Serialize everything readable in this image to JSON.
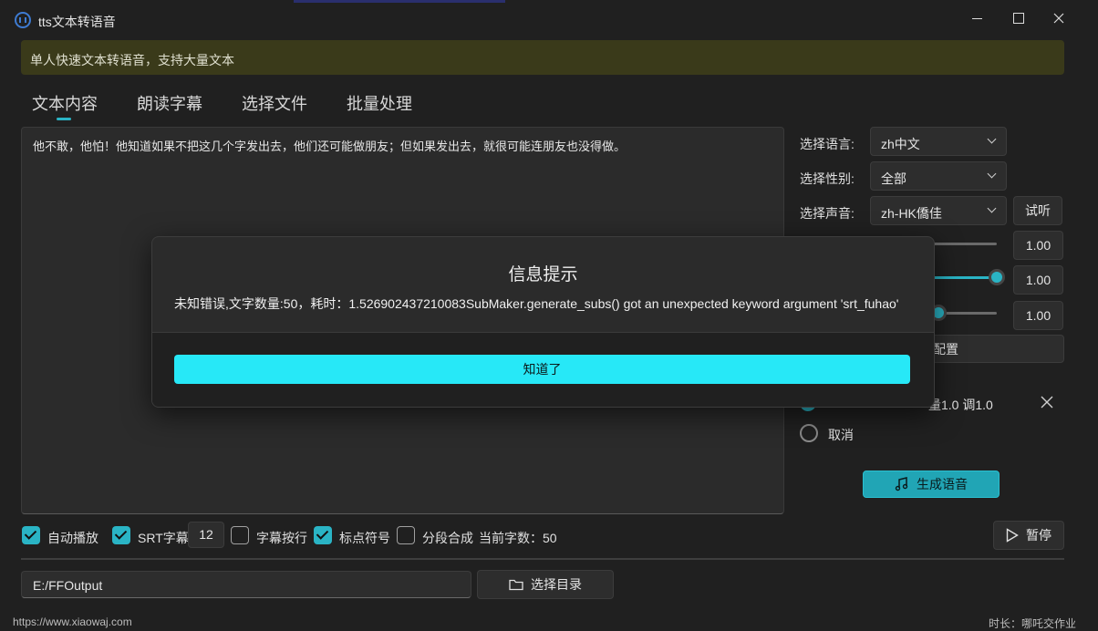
{
  "window": {
    "title": "tts文本转语音"
  },
  "banner": {
    "text": "单人快速文本转语音，支持大量文本"
  },
  "tabs": [
    {
      "label": "文本内容",
      "active": true
    },
    {
      "label": "朗读字幕"
    },
    {
      "label": "选择文件"
    },
    {
      "label": "批量处理"
    }
  ],
  "editor": {
    "text": "他不敢，他怕！他知道如果不把这几个字发出去，他们还可能做朋友；但如果发出去，就很可能连朋友也没得做。"
  },
  "settings": {
    "language_label": "选择语言:",
    "language_value": "zh中文",
    "gender_label": "选择性别:",
    "gender_value": "全部",
    "voice_label": "选择声音:",
    "voice_value": "zh-HK僑佳",
    "listen_button": "试听",
    "sliders": [
      {
        "value": "1.00",
        "level": 0.0
      },
      {
        "value": "1.00",
        "level": 1.0
      },
      {
        "value": "1.00",
        "level": 0.25
      }
    ],
    "config_button": "配置",
    "radio_option_1": "量1.0 调1.0",
    "radio_option_2": "取消",
    "generate_button": "生成语音"
  },
  "options": {
    "autoplay_label": "自动播放",
    "srt_label": "SRT字幕",
    "srt_value": "12",
    "line_break_label": "字幕按行",
    "punct_label": "标点符号",
    "segment_label": "分段合成",
    "char_count_label": "当前字数：50",
    "pause_button": "暂停"
  },
  "output": {
    "path": "E:/FFOutput",
    "choose_dir_button": "选择目录"
  },
  "footer": {
    "left": "https://www.xiaowaj.com",
    "right": "时长：哪吒交作业"
  },
  "dialog": {
    "title": "信息提示",
    "message": "未知错误,文字数量:50，耗时：1.526902437210083SubMaker.generate_subs() got an unexpected keyword argument 'srt_fuhao'",
    "ok_button": "知道了"
  },
  "colors": {
    "accent": "#2ab4c5",
    "dialog_button": "#27e8f7",
    "banner_bg": "#3a3a1a"
  }
}
